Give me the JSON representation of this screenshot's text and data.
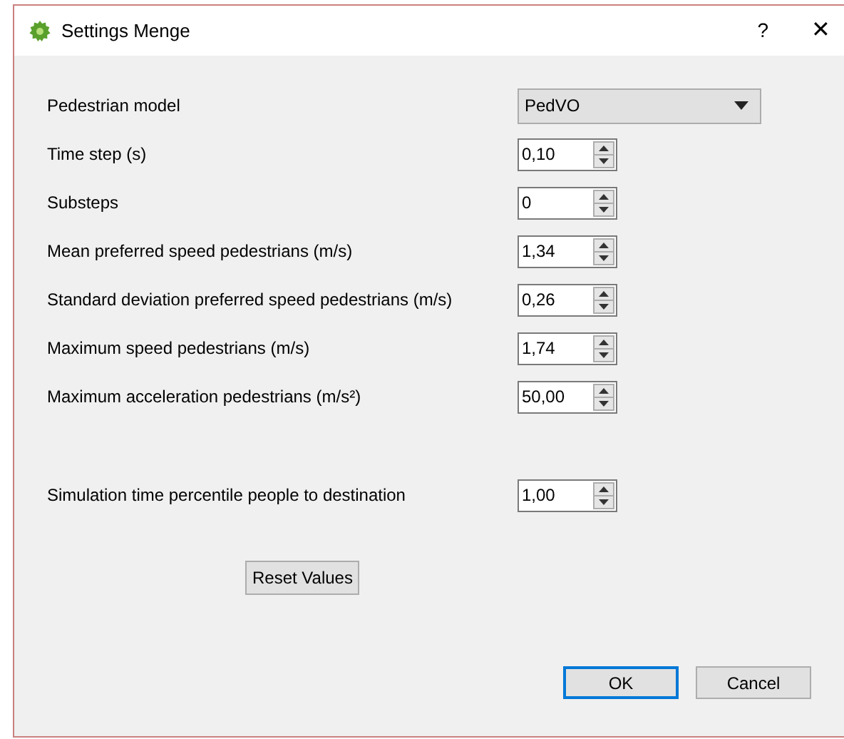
{
  "window": {
    "title": "Settings Menge",
    "help": "?",
    "close": "✕"
  },
  "fields": [
    {
      "kind": "dropdown",
      "label": "Pedestrian model",
      "value": "PedVO"
    },
    {
      "kind": "spin",
      "label": "Time step (s)",
      "value": "0,10"
    },
    {
      "kind": "spin",
      "label": "Substeps",
      "value": "0"
    },
    {
      "kind": "spin",
      "label": "Mean preferred speed pedestrians (m/s)",
      "value": "1,34"
    },
    {
      "kind": "spin",
      "label": "Standard deviation preferred speed pedestrians (m/s)",
      "value": "0,26"
    },
    {
      "kind": "spin",
      "label": "Maximum speed pedestrians (m/s)",
      "value": "1,74"
    },
    {
      "kind": "spin",
      "label": "Maximum acceleration pedestrians (m/s²)",
      "value": "50,00"
    }
  ],
  "percentile_field": {
    "kind": "spin",
    "label": "Simulation time percentile people to destination",
    "value": "1,00"
  },
  "reset_button": "Reset Values",
  "buttons": [
    {
      "label": "OK",
      "focused": true
    },
    {
      "label": "Cancel",
      "focused": false
    }
  ]
}
